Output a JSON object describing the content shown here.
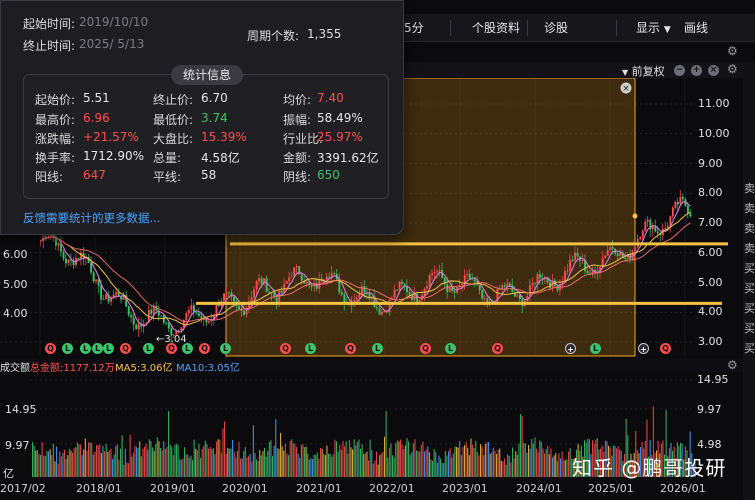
{
  "toolbar": {
    "period_fragment": "5分",
    "stock_info": "个股资料",
    "diagnose": "诊股",
    "display": "显示",
    "draw_line": "画线"
  },
  "chart_header": {
    "adjust": "前复权"
  },
  "popup": {
    "start_time_label": "起始时间:",
    "start_time_value": "2019/10/10",
    "end_time_label": "终止时间:",
    "end_time_value": "2025/  5/13",
    "period_count_label": "周期个数:",
    "period_count_value": "1,355",
    "stats_title": "统计信息",
    "feedback": "反馈需要统计的更多数据...",
    "stats": [
      {
        "label": "起始价:",
        "value": "5.51",
        "color": "#e6e6e6"
      },
      {
        "label": "终止价:",
        "value": "6.70",
        "color": "#e6e6e6"
      },
      {
        "label": "均价:",
        "value": "7.40",
        "color": "#ff4d4f"
      },
      {
        "label": "最高价:",
        "value": "6.96",
        "color": "#ff4d4f"
      },
      {
        "label": "最低价:",
        "value": "3.74",
        "color": "#3cc46a"
      },
      {
        "label": "振幅:",
        "value": "58.49%",
        "color": "#e6e6e6"
      },
      {
        "label": "涨跌幅:",
        "value": "+21.57%",
        "color": "#ff4d4f"
      },
      {
        "label": "大盘比:",
        "value": "15.39%",
        "color": "#ff4d4f"
      },
      {
        "label": "行业比:",
        "value": "25.97%",
        "color": "#ff4d4f"
      },
      {
        "label": "换手率:",
        "value": "1712.90%",
        "color": "#e6e6e6"
      },
      {
        "label": "总量:",
        "value": "4.58亿",
        "color": "#e6e6e6"
      },
      {
        "label": "金额:",
        "value": "3391.62亿",
        "color": "#e6e6e6"
      },
      {
        "label": "阳线:",
        "value": "647",
        "color": "#ff4d4f"
      },
      {
        "label": "平线:",
        "value": "58",
        "color": "#e6e6e6"
      },
      {
        "label": "阴线:",
        "value": "650",
        "color": "#3cc46a"
      }
    ]
  },
  "price_axis": [
    "11.00",
    "10.00",
    "9.00",
    "8.00",
    "7.00",
    "6.00",
    "5.00",
    "4.00",
    "3.00"
  ],
  "left_axis_visible": [
    "6.00",
    "5.00",
    "4.00"
  ],
  "low_annotation": "←3.04",
  "volume": {
    "prefix": "成交额",
    "total_label": "总金额:1177.12万",
    "ma5_label": "MA5:3.06亿",
    "ma10_label": "MA10:3.05亿",
    "axis": [
      "14.95",
      "9.97",
      "4.98"
    ],
    "unit": "亿",
    "colors": {
      "total": "#ff4d4f",
      "ma5": "#f5c242",
      "ma10": "#4aa3ff"
    }
  },
  "x_axis": [
    "2017/02",
    "2018/01",
    "2019/01",
    "2020/01",
    "2021/01",
    "2022/01",
    "2023/01",
    "2024/01",
    "2025/01",
    "2026/01"
  ],
  "watermark": "知乎 @鹏哥投研",
  "right_strip_chars": [
    "卖",
    "卖",
    "卖",
    "卖",
    "买",
    "买",
    "买",
    "买",
    "买"
  ],
  "colors": {
    "up": "#ff4d4f",
    "down": "#3cc46a",
    "selection_border": "#f5a623",
    "hline": "#f5c242",
    "ma_line": "#d07fd8"
  },
  "chart_data": {
    "type": "line",
    "title": "",
    "xlabel": "",
    "ylabel": "",
    "x": [
      "2017/02",
      "2018/01",
      "2019/01",
      "2020/01",
      "2021/01",
      "2022/01",
      "2023/01",
      "2024/01",
      "2025/01",
      "2026/01"
    ],
    "series": [
      {
        "values": [
          6.4,
          4.6,
          3.3,
          5.0,
          4.8,
          4.6,
          4.9,
          4.7,
          6.3,
          7.2
        ]
      }
    ],
    "ylim": [
      3.0,
      11.0
    ],
    "selection": {
      "start": "2019/10/10",
      "end": "2025/5/13"
    },
    "horizontal_lines": [
      6.3,
      4.3
    ]
  }
}
